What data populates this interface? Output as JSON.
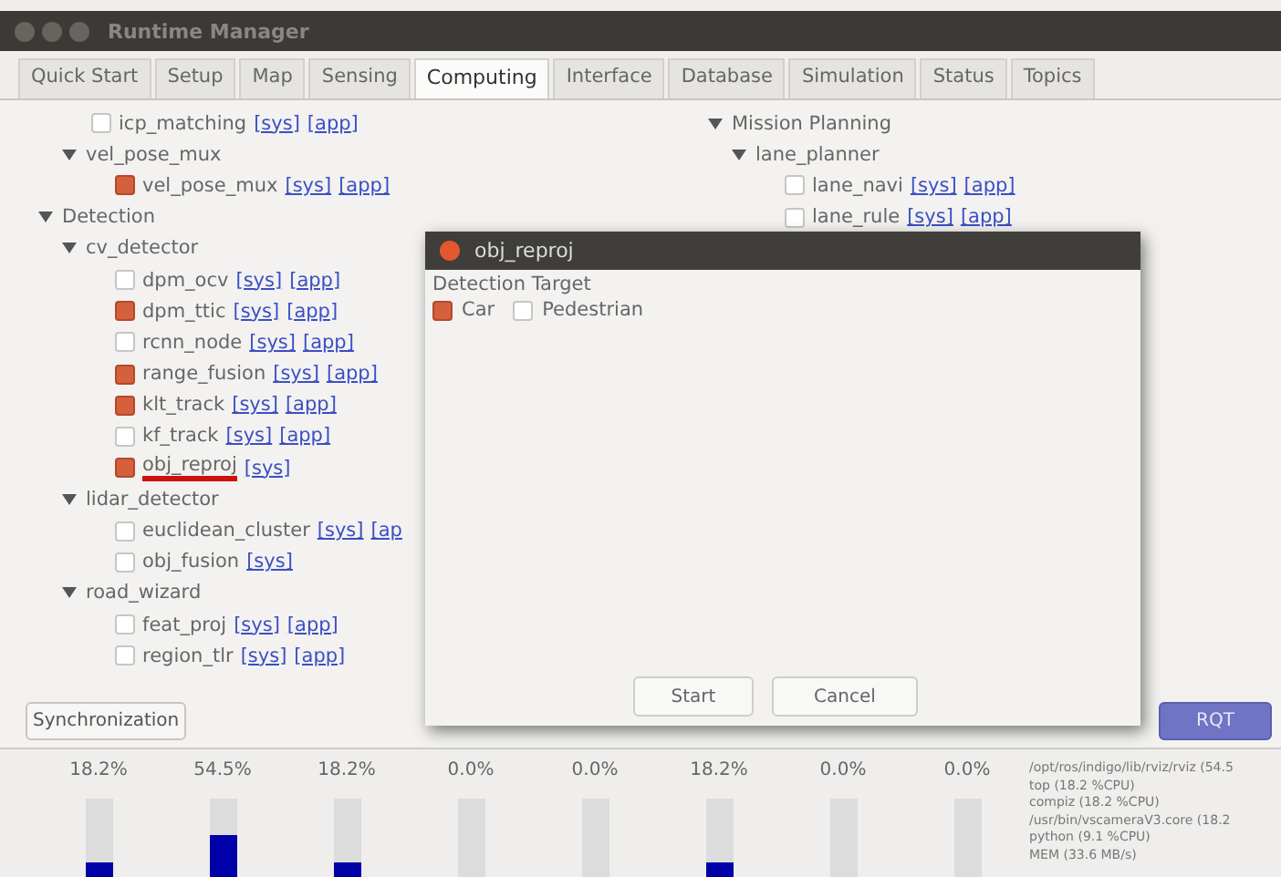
{
  "window": {
    "title": "Runtime Manager"
  },
  "tabs": [
    {
      "label": "Quick Start",
      "selected": false
    },
    {
      "label": "Setup",
      "selected": false
    },
    {
      "label": "Map",
      "selected": false
    },
    {
      "label": "Sensing",
      "selected": false
    },
    {
      "label": "Computing",
      "selected": true
    },
    {
      "label": "Interface",
      "selected": false
    },
    {
      "label": "Database",
      "selected": false
    },
    {
      "label": "Simulation",
      "selected": false
    },
    {
      "label": "Status",
      "selected": false
    },
    {
      "label": "Topics",
      "selected": false
    }
  ],
  "tree_left": [
    {
      "kind": "group",
      "children": [
        {
          "kind": "leaf",
          "label": "icp_matching",
          "checked": false,
          "links": [
            "[sys]",
            "[app]"
          ]
        },
        {
          "kind": "group",
          "label": "vel_pose_mux",
          "expanded": true,
          "children": [
            {
              "kind": "leaf",
              "label": "vel_pose_mux",
              "checked": true,
              "links": [
                "[sys]",
                "[app]"
              ]
            }
          ]
        }
      ]
    },
    {
      "kind": "group",
      "label": "Detection",
      "expanded": true,
      "children": [
        {
          "kind": "group",
          "label": "cv_detector",
          "expanded": true,
          "children": [
            {
              "kind": "leaf",
              "label": "dpm_ocv",
              "checked": false,
              "links": [
                "[sys]",
                "[app]"
              ]
            },
            {
              "kind": "leaf",
              "label": "dpm_ttic",
              "checked": true,
              "links": [
                "[sys]",
                "[app]"
              ]
            },
            {
              "kind": "leaf",
              "label": "rcnn_node",
              "checked": false,
              "links": [
                "[sys]",
                "[app]"
              ]
            },
            {
              "kind": "leaf",
              "label": "range_fusion",
              "checked": true,
              "links": [
                "[sys]",
                "[app]"
              ]
            },
            {
              "kind": "leaf",
              "label": "klt_track",
              "checked": true,
              "links": [
                "[sys]",
                "[app]"
              ]
            },
            {
              "kind": "leaf",
              "label": "kf_track",
              "checked": false,
              "links": [
                "[sys]",
                "[app]"
              ]
            },
            {
              "kind": "leaf",
              "label": "obj_reproj",
              "checked": true,
              "underlined": true,
              "links": [
                "[sys]"
              ]
            }
          ]
        },
        {
          "kind": "group",
          "label": "lidar_detector",
          "expanded": true,
          "children": [
            {
              "kind": "leaf",
              "label": "euclidean_cluster",
              "checked": false,
              "links": [
                "[sys]",
                "[ap"
              ]
            },
            {
              "kind": "leaf",
              "label": "obj_fusion",
              "checked": false,
              "links": [
                "[sys]"
              ]
            }
          ]
        },
        {
          "kind": "group",
          "label": "road_wizard",
          "expanded": true,
          "children": [
            {
              "kind": "leaf",
              "label": "feat_proj",
              "checked": false,
              "links": [
                "[sys]",
                "[app]"
              ]
            },
            {
              "kind": "leaf",
              "label": "region_tlr",
              "checked": false,
              "links": [
                "[sys]",
                "[app]"
              ]
            }
          ]
        }
      ]
    }
  ],
  "tree_right": [
    {
      "kind": "group",
      "label": "Mission Planning",
      "expanded": true,
      "children": [
        {
          "kind": "group",
          "label": "lane_planner",
          "expanded": true,
          "children": [
            {
              "kind": "leaf",
              "label": "lane_navi",
              "checked": false,
              "links": [
                "[sys]",
                "[app]"
              ]
            },
            {
              "kind": "leaf",
              "label": "lane_rule",
              "checked": false,
              "links": [
                "[sys]",
                "[app]"
              ]
            }
          ]
        }
      ]
    }
  ],
  "buttons": [
    {
      "label": "Synchronization",
      "kind": "plain"
    },
    {
      "label": "RQT",
      "kind": "accent"
    }
  ],
  "dialog": {
    "title": "obj_reproj",
    "group_label": "Detection Target",
    "options": [
      {
        "label": "Car",
        "checked": true
      },
      {
        "label": "Pedestrian",
        "checked": false
      }
    ],
    "buttons": [
      "Start",
      "Cancel"
    ]
  },
  "meters": [
    {
      "reading": "18.2%",
      "level": 0.182
    },
    {
      "reading": "54.5%",
      "level": 0.545
    },
    {
      "reading": "18.2%",
      "level": 0.182
    },
    {
      "reading": "0.0%",
      "level": 0
    },
    {
      "reading": "0.0%",
      "level": 0
    },
    {
      "reading": "18.2%",
      "level": 0.182
    },
    {
      "reading": "0.0%",
      "level": 0
    },
    {
      "reading": "0.0%",
      "level": 0
    }
  ],
  "process_info": [
    "/opt/ros/indigo/lib/rviz/rviz (54.5",
    "top (18.2 %CPU)",
    "compiz (18.2 %CPU)",
    "/usr/bin/vscameraV3.core (18.2",
    "python (9.1 %CPU)",
    "MEM (33.6 MB/s)"
  ]
}
